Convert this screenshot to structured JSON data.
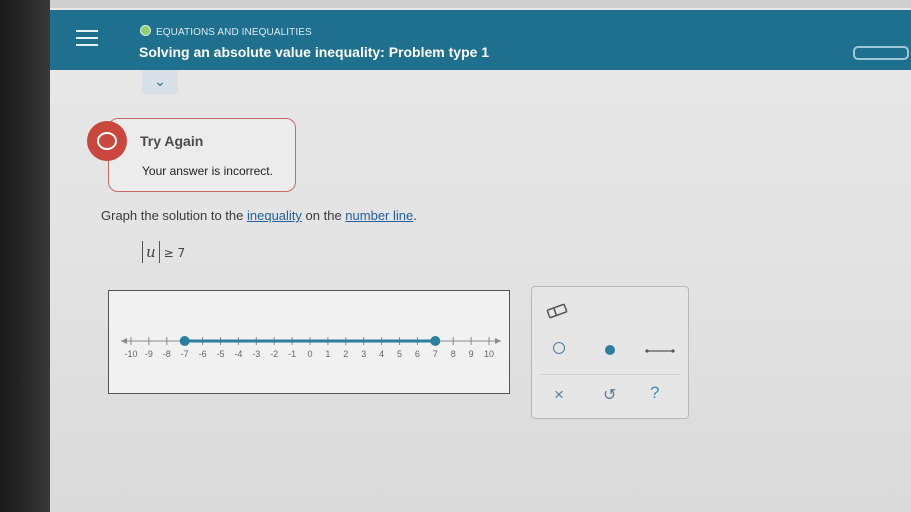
{
  "header": {
    "topic": "EQUATIONS AND INEQUALITIES",
    "title": "Solving an absolute value inequality: Problem type 1"
  },
  "feedback": {
    "title": "Try Again",
    "message": "Your answer is incorrect."
  },
  "question": {
    "prefix": "Graph the solution to the ",
    "link1": "inequality",
    "middle": " on the ",
    "link2": "number line",
    "suffix": "."
  },
  "inequality": {
    "variable": "u",
    "relation": "≥ 7"
  },
  "number_line": {
    "ticks": [
      "-10",
      "-9",
      "-8",
      "-7",
      "-6",
      "-5",
      "-4",
      "-3",
      "-2",
      "-1",
      "0",
      "1",
      "2",
      "3",
      "4",
      "5",
      "6",
      "7",
      "8",
      "9",
      "10"
    ],
    "min": -10,
    "max": 10,
    "plotted_points": [
      -7,
      7
    ],
    "point_style": "closed",
    "shaded_segment": [
      -7,
      7
    ],
    "colors": {
      "plot": "#2b7fa1",
      "axis": "#8a8a8a"
    }
  },
  "tools": {
    "icons": [
      "eraser-icon",
      "open-dot-icon",
      "closed-dot-icon",
      "segment-icon",
      "close-icon",
      "undo-icon",
      "help-icon"
    ],
    "close_glyph": "×",
    "undo_glyph": "↺",
    "help_glyph": "?",
    "accent": "#4a7fa0"
  }
}
